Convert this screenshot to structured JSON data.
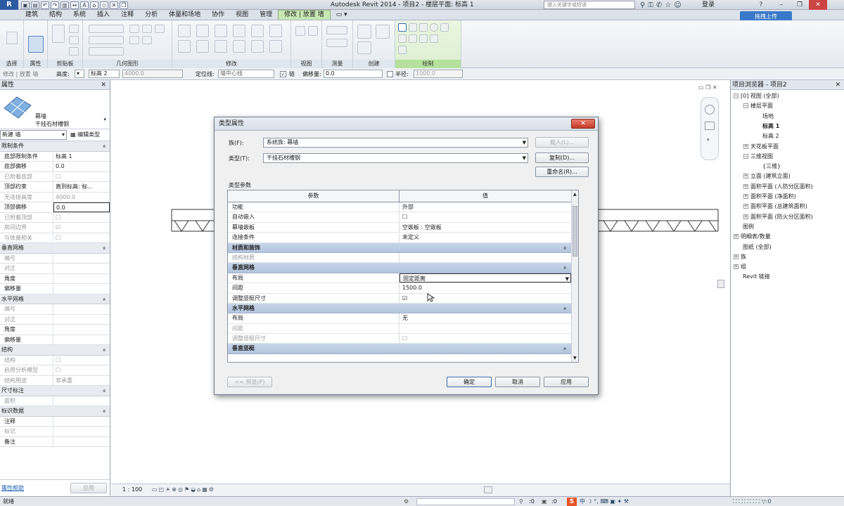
{
  "titlebar": {
    "app_logo": "R",
    "title": "Autodesk Revit 2014 -    项目2 - 楼层平面: 标高 1",
    "search_placeholder": "键入关键字或短语",
    "login": "登录"
  },
  "ribbon": {
    "tabs": [
      "建筑",
      "结构",
      "系统",
      "插入",
      "注释",
      "分析",
      "体量和场地",
      "协作",
      "视图",
      "管理",
      "修改 | 放置 墙"
    ],
    "active_tab": "修改 | 放置 墙",
    "groups": [
      "选择",
      "属性",
      "剪贴板",
      "几何图形",
      "修改",
      "视图",
      "测量",
      "创建",
      "绘制"
    ],
    "share_button": "拖拽上传"
  },
  "options_bar": {
    "context": "修改 | 放置 墙",
    "height_label": "高度:",
    "level": "标高 2",
    "height_value": "4000.0",
    "location_label": "定位线:",
    "location_value": "墙中心线",
    "chain_label": "链",
    "offset_label": "偏移量:",
    "offset_value": "0.0",
    "radius_label": "半径:",
    "radius_value": "1000.0"
  },
  "properties": {
    "title": "属性",
    "type_line1": "幕墙",
    "type_line2": "干挂石材槽钢",
    "new_selector": "新建 墙",
    "edit_type": "编辑类型",
    "sections": [
      {
        "name": "限制条件",
        "rows": [
          [
            "底部限制条件",
            "标高 1",
            false
          ],
          [
            "底部偏移",
            "0.0",
            false
          ],
          [
            "已附着底部",
            "☐",
            true
          ],
          [
            "顶部约束",
            "直到标高: 标...",
            false
          ],
          [
            "无连接高度",
            "4000.0",
            true
          ],
          [
            "顶部偏移",
            "0.0",
            false
          ],
          [
            "已附着顶部",
            "☐",
            true
          ],
          [
            "房间边界",
            "☑",
            true
          ],
          [
            "与体量相关",
            "☐",
            true
          ]
        ]
      },
      {
        "name": "垂直网格",
        "rows": [
          [
            "编号",
            "",
            true
          ],
          [
            "对正",
            "",
            true
          ],
          [
            "角度",
            "",
            false
          ],
          [
            "偏移量",
            "",
            false
          ]
        ]
      },
      {
        "name": "水平网格",
        "rows": [
          [
            "编号",
            "",
            true
          ],
          [
            "对正",
            "",
            true
          ],
          [
            "角度",
            "",
            false
          ],
          [
            "偏移量",
            "",
            false
          ]
        ]
      },
      {
        "name": "结构",
        "rows": [
          [
            "结构",
            "☐",
            true
          ],
          [
            "启用分析模型",
            "☐",
            true
          ],
          [
            "结构用途",
            "非承重",
            true
          ]
        ]
      },
      {
        "name": "尺寸标注",
        "rows": [
          [
            "面积",
            "",
            true
          ]
        ]
      },
      {
        "name": "标识数据",
        "rows": [
          [
            "注释",
            "",
            false
          ],
          [
            "标记",
            "",
            true
          ],
          [
            "备注",
            "",
            false
          ]
        ]
      }
    ],
    "help_link": "属性帮助",
    "apply": "应用"
  },
  "project_browser": {
    "title": "项目浏览器 - 项目2",
    "nodes": [
      {
        "label": "[0] 视图 (全部)",
        "indent": 0,
        "toggle": "−",
        "bold": false
      },
      {
        "label": "楼层平面",
        "indent": 1,
        "toggle": "−",
        "bold": false
      },
      {
        "label": "场地",
        "indent": 2,
        "toggle": "",
        "bold": false
      },
      {
        "label": "标高 1",
        "indent": 2,
        "toggle": "",
        "bold": true
      },
      {
        "label": "标高 2",
        "indent": 2,
        "toggle": "",
        "bold": false
      },
      {
        "label": "天花板平面",
        "indent": 1,
        "toggle": "+",
        "bold": false
      },
      {
        "label": "三维视图",
        "indent": 1,
        "toggle": "−",
        "bold": false
      },
      {
        "label": "{三维}",
        "indent": 2,
        "toggle": "",
        "bold": false
      },
      {
        "label": "立面 (建筑立面)",
        "indent": 1,
        "toggle": "+",
        "bold": false
      },
      {
        "label": "面积平面 (人防分区面积)",
        "indent": 1,
        "toggle": "+",
        "bold": false
      },
      {
        "label": "面积平面 (净面积)",
        "indent": 1,
        "toggle": "+",
        "bold": false
      },
      {
        "label": "面积平面 (总建筑面积)",
        "indent": 1,
        "toggle": "+",
        "bold": false
      },
      {
        "label": "面积平面 (防火分区面积)",
        "indent": 1,
        "toggle": "+",
        "bold": false
      },
      {
        "label": "图例",
        "indent": 0,
        "toggle": "",
        "bold": false
      },
      {
        "label": "明细表/数量",
        "indent": 0,
        "toggle": "+",
        "bold": false
      },
      {
        "label": "图纸 (全部)",
        "indent": 0,
        "toggle": "",
        "bold": false
      },
      {
        "label": "族",
        "indent": 0,
        "toggle": "+",
        "bold": false
      },
      {
        "label": "组",
        "indent": 0,
        "toggle": "+",
        "bold": false
      },
      {
        "label": "Revit 链接",
        "indent": 0,
        "toggle": "",
        "bold": false
      }
    ]
  },
  "view": {
    "scale": "1 : 100",
    "status_left": "就绪",
    "status_zero1": ":0",
    "status_zero2": ":0"
  },
  "dialog": {
    "title": "类型属性",
    "family_label": "族(F):",
    "family_value": "系统族: 幕墙",
    "type_label": "类型(T):",
    "type_value": "干挂石材槽钢",
    "load_button": "载入(L)...",
    "duplicate_button": "复制(D)...",
    "rename_button": "重命名(R)...",
    "params_title": "类型参数",
    "col_param": "参数",
    "col_value": "值",
    "rows": [
      {
        "k": "功能",
        "v": "外部",
        "kind": "row"
      },
      {
        "k": "自动嵌入",
        "v": "☐",
        "kind": "row"
      },
      {
        "k": "幕墙嵌板",
        "v": "空嵌板 : 空嵌板",
        "kind": "row"
      },
      {
        "k": "连接条件",
        "v": "未定义",
        "kind": "row"
      },
      {
        "k": "材质和装饰",
        "v": "",
        "kind": "sec"
      },
      {
        "k": "结构材质",
        "v": "",
        "kind": "gray"
      },
      {
        "k": "垂直网格",
        "v": "",
        "kind": "sec"
      },
      {
        "k": "布局",
        "v": "固定距离",
        "kind": "select"
      },
      {
        "k": "间距",
        "v": "1500.0",
        "kind": "row"
      },
      {
        "k": "调整竖梃尺寸",
        "v": "☑",
        "kind": "row"
      },
      {
        "k": "水平网格",
        "v": "",
        "kind": "sec"
      },
      {
        "k": "布局",
        "v": "无",
        "kind": "row"
      },
      {
        "k": "间距",
        "v": "",
        "kind": "gray"
      },
      {
        "k": "调整竖梃尺寸",
        "v": "☐",
        "kind": "gray"
      },
      {
        "k": "垂直竖梃",
        "v": "",
        "kind": "sec"
      }
    ],
    "preview_button": "<< 预览(P)",
    "ok_button": "确定",
    "cancel_button": "取消",
    "apply_button": "应用"
  }
}
